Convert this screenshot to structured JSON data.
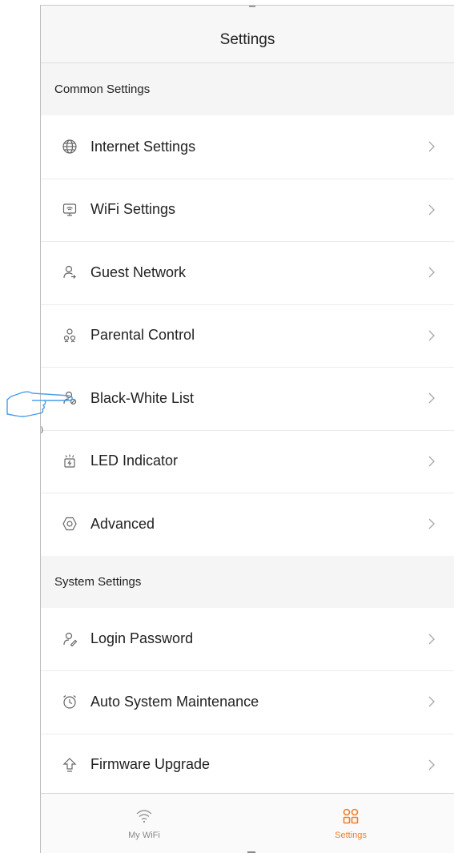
{
  "header": {
    "title": "Settings"
  },
  "sections": [
    {
      "title": "Common Settings",
      "items": [
        {
          "label": "Internet Settings",
          "icon": "globe-icon"
        },
        {
          "label": "WiFi Settings",
          "icon": "wifi-settings-icon"
        },
        {
          "label": "Guest Network",
          "icon": "guest-user-icon"
        },
        {
          "label": "Parental Control",
          "icon": "parental-control-icon"
        },
        {
          "label": "Black-White List",
          "icon": "black-white-list-icon"
        },
        {
          "label": "LED Indicator",
          "icon": "led-indicator-icon"
        },
        {
          "label": "Advanced",
          "icon": "advanced-hexagon-icon"
        }
      ]
    },
    {
      "title": "System Settings",
      "items": [
        {
          "label": "Login Password",
          "icon": "login-password-icon"
        },
        {
          "label": "Auto System Maintenance",
          "icon": "alarm-clock-icon"
        },
        {
          "label": "Firmware Upgrade",
          "icon": "upgrade-arrow-icon"
        }
      ]
    }
  ],
  "tabbar": {
    "tabs": [
      {
        "label": "My WiFi",
        "icon": "wifi-icon",
        "active": false
      },
      {
        "label": "Settings",
        "icon": "settings-grid-icon",
        "active": true
      }
    ]
  },
  "colors": {
    "accent": "#f07e26",
    "text": "#222222",
    "muted": "#888888",
    "background": "#f5f5f5"
  },
  "overlay": {
    "pointer": "hand-pointer-icon"
  }
}
